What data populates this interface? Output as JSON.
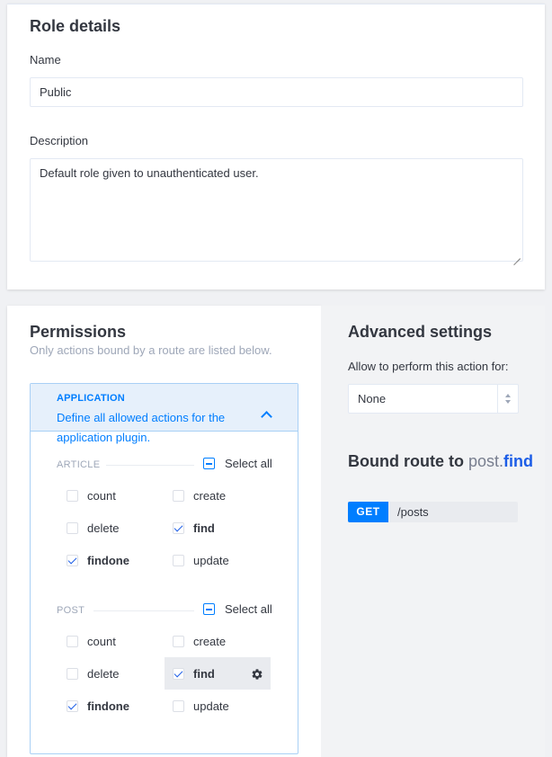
{
  "role_details": {
    "title": "Role details",
    "name_label": "Name",
    "name_value": "Public",
    "description_label": "Description",
    "description_value": "Default role given to unauthenticated user."
  },
  "permissions": {
    "title": "Permissions",
    "subtitle": "Only actions bound by a route are listed below.",
    "plugin": {
      "name": "APPLICATION",
      "description": "Define all allowed actions for the application plugin."
    },
    "sections": [
      {
        "label": "ARTICLE",
        "select_all": "Select all",
        "actions": [
          {
            "label": "count",
            "checked": false
          },
          {
            "label": "create",
            "checked": false
          },
          {
            "label": "delete",
            "checked": false
          },
          {
            "label": "find",
            "checked": true
          },
          {
            "label": "findone",
            "checked": true
          },
          {
            "label": "update",
            "checked": false
          }
        ]
      },
      {
        "label": "POST",
        "select_all": "Select all",
        "actions": [
          {
            "label": "count",
            "checked": false
          },
          {
            "label": "create",
            "checked": false
          },
          {
            "label": "delete",
            "checked": false
          },
          {
            "label": "find",
            "checked": true
          },
          {
            "label": "findone",
            "checked": true
          },
          {
            "label": "update",
            "checked": false
          }
        ]
      }
    ]
  },
  "advanced": {
    "title": "Advanced settings",
    "policy_label": "Allow to perform this action for:",
    "policy_value": "None",
    "route_title_prefix": "Bound route to",
    "route_controller": "post.",
    "route_action": "find",
    "route_method": "GET",
    "route_path": "/posts"
  },
  "colors": {
    "accent": "#007eff",
    "checkmark": "#1c5de7",
    "panel_bg": "#f2f3f5"
  },
  "icons": {
    "expand": "chevron-up-icon",
    "settings": "gear-icon",
    "select_arrows": "sort-arrows-icon"
  }
}
